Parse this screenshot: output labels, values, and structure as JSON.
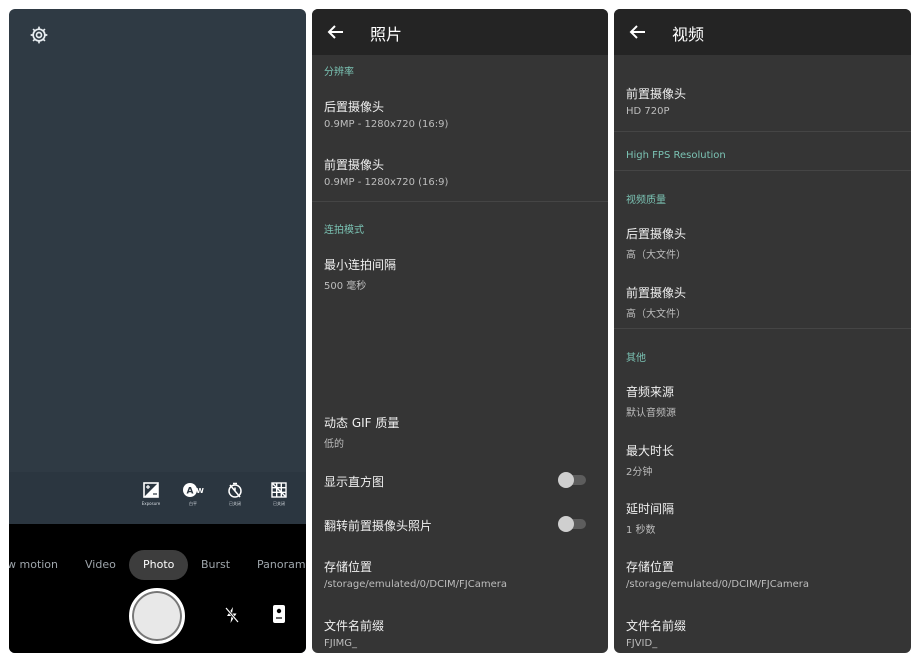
{
  "camera": {
    "tools": [
      {
        "icon": "exposure-icon",
        "label": "Exposure"
      },
      {
        "icon": "white-balance-icon",
        "label": "白平"
      },
      {
        "icon": "timer-icon",
        "label": "已关闭"
      },
      {
        "icon": "grid-icon",
        "label": "已关闭"
      }
    ],
    "modes": [
      "w motion",
      "Video",
      "Photo",
      "Burst",
      "Panorama"
    ],
    "active_mode": "Photo"
  },
  "photo_settings": {
    "title": "照片",
    "sections": {
      "resolution": "分辨率",
      "burst": "连拍模式"
    },
    "items": {
      "rear_camera": {
        "title": "后置摄像头",
        "value": "0.9MP - 1280x720 (16:9)"
      },
      "front_camera": {
        "title": "前置摄像头",
        "value": "0.9MP - 1280x720 (16:9)"
      },
      "min_burst_interval": {
        "title": "最小连拍间隔",
        "value": "500 毫秒"
      },
      "gif_quality": {
        "title": "动态 GIF 质量",
        "value": "低的"
      },
      "show_histogram": {
        "title": "显示直方图",
        "on": false
      },
      "mirror_front": {
        "title": "翻转前置摄像头照片",
        "on": false
      },
      "storage": {
        "title": "存储位置",
        "value": "/storage/emulated/0/DCIM/FJCamera"
      },
      "file_prefix": {
        "title": "文件名前缀",
        "value": "FJIMG_"
      }
    }
  },
  "video_settings": {
    "title": "视频",
    "sections": {
      "high_fps": "High FPS Resolution",
      "quality": "视频质量",
      "other": "其他"
    },
    "items": {
      "front_camera_res": {
        "title": "前置摄像头",
        "value": "HD 720P"
      },
      "rear_quality": {
        "title": "后置摄像头",
        "value": "高（大文件）"
      },
      "front_quality": {
        "title": "前置摄像头",
        "value": "高（大文件）"
      },
      "audio_source": {
        "title": "音频来源",
        "value": "默认音频源"
      },
      "max_duration": {
        "title": "最大时长",
        "value": "2分钟"
      },
      "delay": {
        "title": "延时间隔",
        "value": "1 秒数"
      },
      "storage": {
        "title": "存储位置",
        "value": "/storage/emulated/0/DCIM/FJCamera"
      },
      "file_prefix": {
        "title": "文件名前缀",
        "value": "FJVID_"
      }
    }
  },
  "colors": {
    "accent": "#7bc3b4",
    "camera_preview": "#2f3a44",
    "settings_bg": "#353535",
    "appbar_bg": "#242424"
  }
}
